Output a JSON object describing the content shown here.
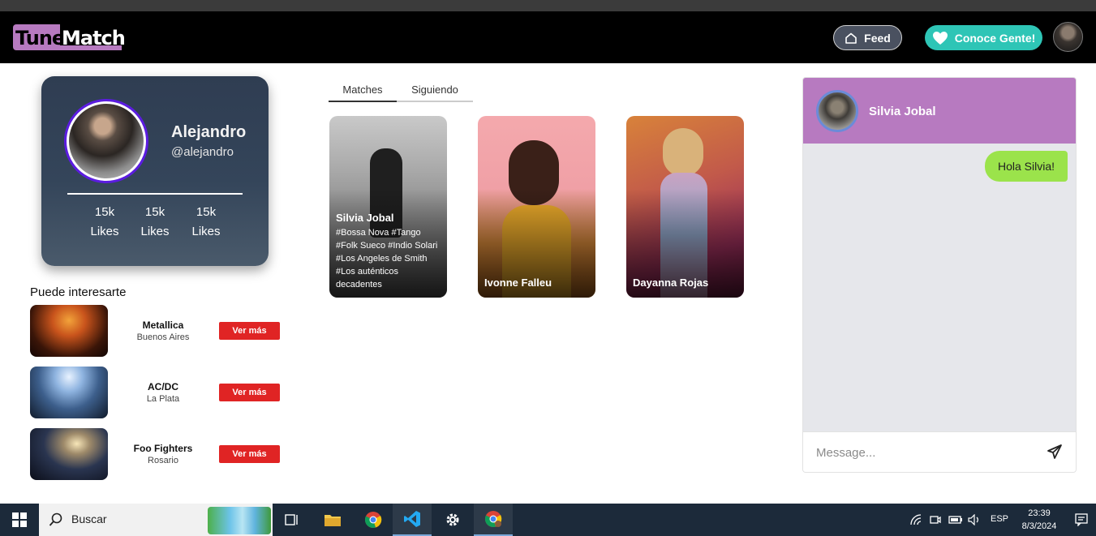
{
  "app": {
    "logo_part1": "Tune",
    "logo_part2": "Match"
  },
  "nav": {
    "feed_label": "Feed",
    "gente_label": "Conoce Gente!",
    "feed_icon": "home-icon",
    "gente_icon": "heart-icon"
  },
  "profile": {
    "name": "Alejandro",
    "handle": "@alejandro",
    "stats": [
      {
        "value": "15k",
        "label": "Likes"
      },
      {
        "value": "15k",
        "label": "Likes"
      },
      {
        "value": "15k",
        "label": "Likes"
      }
    ]
  },
  "suggestions": {
    "title": "Puede interesarte",
    "items": [
      {
        "name": "Metallica",
        "city": "Buenos Aires",
        "button": "Ver más"
      },
      {
        "name": "AC/DC",
        "city": "La Plata",
        "button": "Ver más"
      },
      {
        "name": "Foo Fighters",
        "city": "Rosario",
        "button": "Ver más"
      }
    ]
  },
  "tabs": [
    {
      "label": "Matches",
      "active": true
    },
    {
      "label": "Siguiendo",
      "active": false
    }
  ],
  "matches": [
    {
      "name": "Silvia Jobal",
      "tags": "#Bossa Nova #Tango #Folk Sueco #Indio Solari #Los Angeles de Smith #Los auténticos decadentes"
    },
    {
      "name": "Ivonne Falleu",
      "tags": ""
    },
    {
      "name": "Dayanna Rojas",
      "tags": ""
    }
  ],
  "chat": {
    "contact_name": "Silvia Jobal",
    "messages": [
      {
        "text": "Hola Silvia!",
        "from": "me"
      }
    ],
    "input_placeholder": "Message...",
    "send_icon": "send-icon"
  },
  "taskbar": {
    "search_label": "Buscar",
    "language": "ESP",
    "time": "23:39",
    "date": "8/3/2024"
  },
  "colors": {
    "accent_purple": "#b77ac0",
    "accent_teal": "#2ec5b6",
    "button_red": "#e02424",
    "bubble_green": "#9be34b"
  }
}
